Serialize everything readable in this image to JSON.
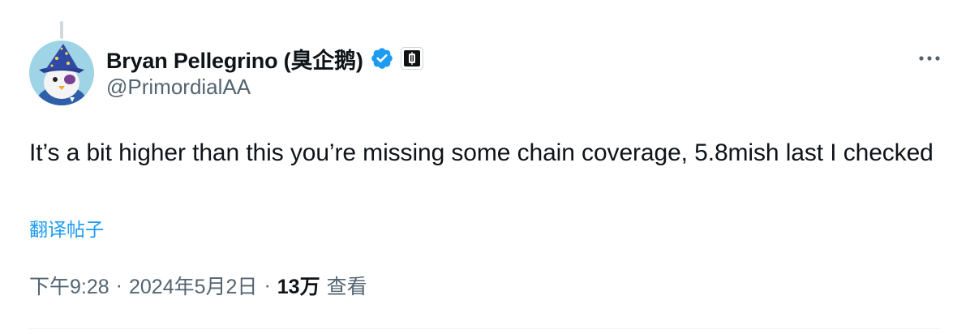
{
  "author": {
    "display_name": "Bryan Pellegrino (臭企鹅)",
    "handle": "@PrimordialAA"
  },
  "tweet": {
    "text": "It’s a bit higher than this you’re missing some chain coverage, 5.8mish last I checked",
    "translate_label": "翻译帖子"
  },
  "meta": {
    "time": "下午9:28",
    "separator": "·",
    "date": "2024年5月2日",
    "views_count": "13万",
    "views_label": "查看"
  },
  "icons": {
    "avatar": "penguin-wizard-avatar",
    "verified": "verified-badge-icon",
    "affiliation": "affiliation-badge-icon",
    "more": "more-horizontal-icon"
  },
  "colors": {
    "accent": "#1d9bf0",
    "text": "#0f1419",
    "secondary": "#536471",
    "divider": "#eff3f4"
  }
}
